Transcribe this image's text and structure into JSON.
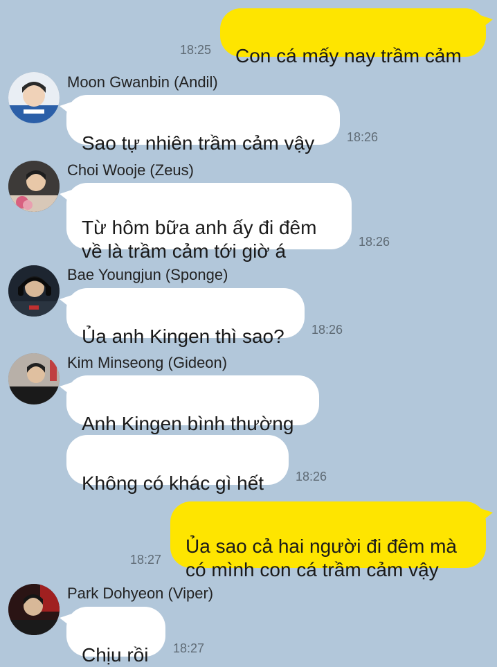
{
  "messages": [
    {
      "text": "Con cá mấy nay trầm cảm",
      "time": "18:25"
    },
    {
      "sender": "Moon Gwanbin (Andil)",
      "text": "Sao tự nhiên trầm cảm vậy",
      "time": "18:26"
    },
    {
      "sender": "Choi Wooje (Zeus)",
      "text": "Từ hôm bữa anh ấy đi đêm\nvề là trầm cảm tới giờ á",
      "time": "18:26"
    },
    {
      "sender": "Bae Youngjun (Sponge)",
      "text": "Ủa anh Kingen thì sao?",
      "time": "18:26"
    },
    {
      "sender": "Kim Minseong (Gideon)",
      "text": "Anh Kingen bình thường"
    },
    {
      "text": "Không có khác gì hết",
      "time": "18:26"
    },
    {
      "text": "Ủa sao cả hai người đi đêm mà\ncó mình con cá trầm cảm vậy",
      "time": "18:27"
    },
    {
      "sender": "Park Dohyeon (Viper)",
      "text": "Chịu rồi",
      "time": "18:27"
    }
  ],
  "colors": {
    "background": "#b2c7da",
    "outgoing_bubble": "#fee500",
    "incoming_bubble": "#ffffff",
    "timestamp": "#5f6b75"
  },
  "icons": {
    "avatar": "profile-photo"
  }
}
